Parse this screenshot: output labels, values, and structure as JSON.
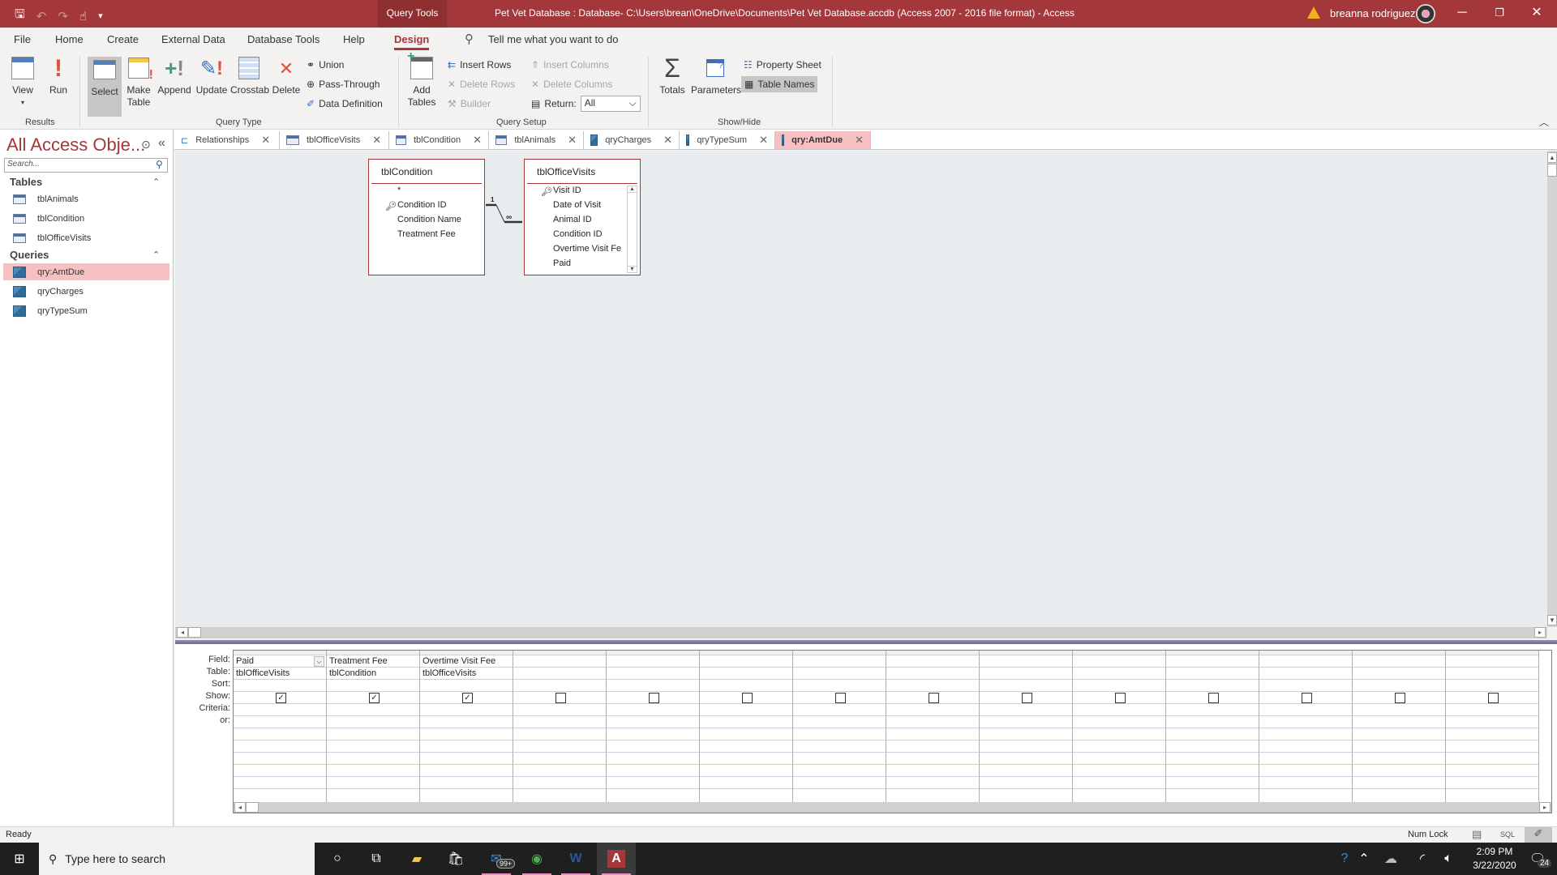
{
  "titlebar": {
    "context_tab": "Query Tools",
    "title": "Pet Vet Database : Database- C:\\Users\\brean\\OneDrive\\Documents\\Pet Vet Database.accdb (Access 2007 - 2016 file format)  -  Access",
    "user": "breanna rodriguez",
    "qat_icons": [
      "save-icon",
      "undo-icon",
      "redo-icon",
      "touch-mode-icon",
      "customize-icon"
    ]
  },
  "menu": {
    "tabs": [
      "File",
      "Home",
      "Create",
      "External Data",
      "Database Tools",
      "Help",
      "Design"
    ],
    "active_tab": "Design",
    "tell_me": "Tell me what you want to do"
  },
  "ribbon": {
    "results": {
      "label": "Results",
      "view": "View",
      "run": "Run"
    },
    "query_type": {
      "label": "Query Type",
      "select": "Select",
      "make_table_1": "Make",
      "make_table_2": "Table",
      "append": "Append",
      "update": "Update",
      "crosstab": "Crosstab",
      "delete": "Delete",
      "union": "Union",
      "pass_through": "Pass-Through",
      "data_definition": "Data Definition"
    },
    "query_setup": {
      "label": "Query Setup",
      "add_tables_1": "Add",
      "add_tables_2": "Tables",
      "insert_rows": "Insert Rows",
      "delete_rows": "Delete Rows",
      "builder": "Builder",
      "insert_columns": "Insert Columns",
      "delete_columns": "Delete Columns",
      "return_label": "Return:",
      "return_value": "All"
    },
    "show_hide": {
      "label": "Show/Hide",
      "totals": "Totals",
      "parameters": "Parameters",
      "property_sheet": "Property Sheet",
      "table_names": "Table Names"
    }
  },
  "nav": {
    "title": "All Access Obje...",
    "search_placeholder": "Search...",
    "tables_header": "Tables",
    "tables": [
      "tblAnimals",
      "tblCondition",
      "tblOfficeVisits"
    ],
    "queries_header": "Queries",
    "queries": [
      "qry:AmtDue",
      "qryCharges",
      "qryTypeSum"
    ],
    "selected": "qry:AmtDue"
  },
  "doc_tabs": [
    {
      "label": "Relationships",
      "icon": "relationships-icon"
    },
    {
      "label": "tblOfficeVisits",
      "icon": "table-icon"
    },
    {
      "label": "tblCondition",
      "icon": "table-icon"
    },
    {
      "label": "tblAnimals",
      "icon": "table-icon"
    },
    {
      "label": "qryCharges",
      "icon": "query-icon"
    },
    {
      "label": "qryTypeSum",
      "icon": "query-icon"
    },
    {
      "label": "qry:AmtDue",
      "icon": "query-icon",
      "active": true
    }
  ],
  "field_lists": [
    {
      "name": "tblCondition",
      "fields": [
        "*",
        "Condition ID",
        "Condition Name",
        "Treatment Fee"
      ],
      "key": "Condition ID"
    },
    {
      "name": "tblOfficeVisits",
      "fields": [
        "Visit ID",
        "Date of Visit",
        "Animal ID",
        "Condition ID",
        "Overtime Visit Fe",
        "Paid"
      ],
      "key": "Visit ID"
    }
  ],
  "relationship": {
    "one": "1",
    "many": "∞"
  },
  "qbe": {
    "row_labels": [
      "Field:",
      "Table:",
      "Sort:",
      "Show:",
      "Criteria:",
      "or:"
    ],
    "columns": [
      {
        "field": "Paid",
        "table": "tblOfficeVisits",
        "show": true
      },
      {
        "field": "Treatment Fee",
        "table": "tblCondition",
        "show": true
      },
      {
        "field": "Overtime Visit Fee",
        "table": "tblOfficeVisits",
        "show": true
      },
      {
        "field": "",
        "table": "",
        "show": false
      },
      {
        "field": "",
        "table": "",
        "show": false
      },
      {
        "field": "",
        "table": "",
        "show": false
      },
      {
        "field": "",
        "table": "",
        "show": false
      },
      {
        "field": "",
        "table": "",
        "show": false
      },
      {
        "field": "",
        "table": "",
        "show": false
      },
      {
        "field": "",
        "table": "",
        "show": false
      },
      {
        "field": "",
        "table": "",
        "show": false
      },
      {
        "field": "",
        "table": "",
        "show": false
      },
      {
        "field": "",
        "table": "",
        "show": false
      },
      {
        "field": "",
        "table": "",
        "show": false
      }
    ]
  },
  "status": {
    "left": "Ready",
    "num_lock": "Num Lock",
    "sql": "SQL"
  },
  "taskbar": {
    "search_placeholder": "Type here to search",
    "mail_badge": "99+",
    "time": "2:09 PM",
    "date": "3/22/2020",
    "notifications": "24"
  }
}
